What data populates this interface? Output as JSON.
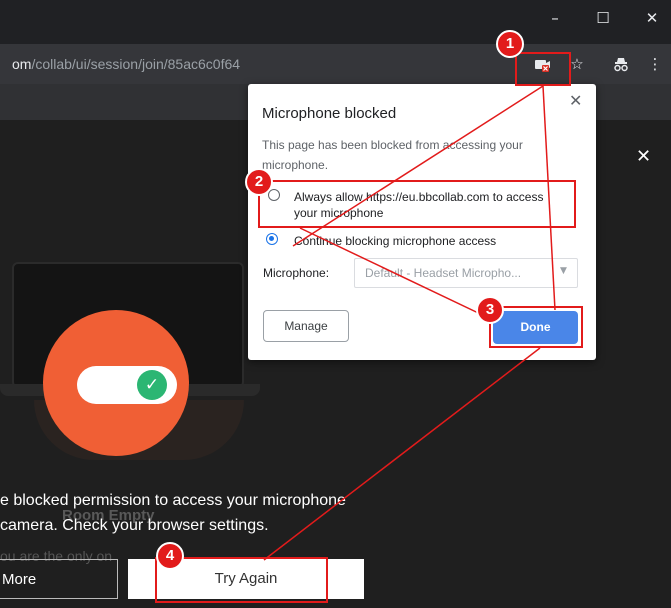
{
  "browser": {
    "url_domain": "om",
    "url_path": "/collab/ui/session/join/85ac6c0f64",
    "window_controls": {
      "minimize": "–",
      "maximize": "☐",
      "close": "✕"
    },
    "toolbar_icons": [
      "camera-blocked-icon",
      "star-icon",
      "incognito-icon",
      "menu-icon"
    ]
  },
  "popup": {
    "title": "Microphone blocked",
    "description": "This page has been blocked from accessing your microphone.",
    "option_allow": "Always allow https://eu.bbcollab.com to access your microphone",
    "option_block": "Continue blocking microphone access",
    "selected_option": "option_block",
    "microphone_label": "Microphone:",
    "microphone_value": "Default - Headset Micropho...",
    "manage_label": "Manage",
    "done_label": "Done"
  },
  "page": {
    "message": "e blocked permission to access your microphone camera. Check your browser settings.",
    "ghost_title": "Room Empty",
    "ghost_sub": "ou are the only on",
    "more_label": "More",
    "try_again_label": "Try Again",
    "close_symbol": "✕"
  },
  "annotations": {
    "badges": [
      "1",
      "2",
      "3",
      "4"
    ],
    "color": "#e21b1b"
  },
  "colors": {
    "done_button": "#4a86e8",
    "avatar_circle": "#f05f35",
    "toggle_check": "#2bb673"
  }
}
